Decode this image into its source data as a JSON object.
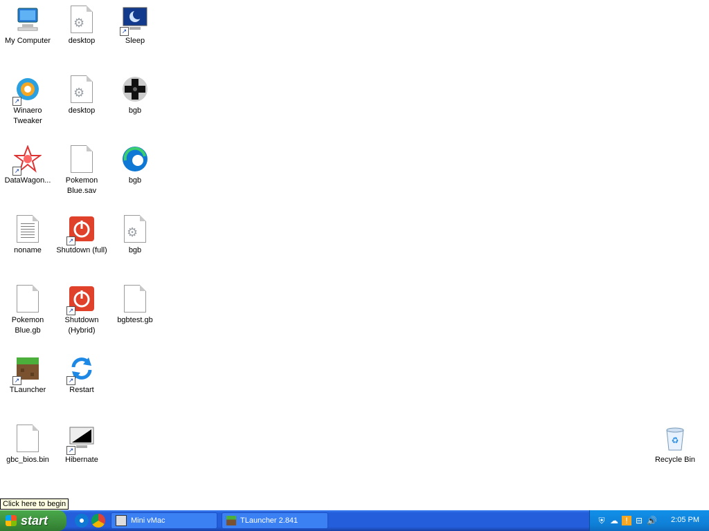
{
  "desktop": {
    "icons": [
      {
        "label": "My Computer"
      },
      {
        "label": "desktop"
      },
      {
        "label": "Sleep"
      },
      {
        "label": "Winaero Tweaker"
      },
      {
        "label": "desktop"
      },
      {
        "label": "bgb"
      },
      {
        "label": "DataWagon..."
      },
      {
        "label": "Pokemon Blue.sav"
      },
      {
        "label": "bgb"
      },
      {
        "label": "noname"
      },
      {
        "label": "Shutdown (full)"
      },
      {
        "label": "bgb"
      },
      {
        "label": "Pokemon Blue.gb"
      },
      {
        "label": "Shutdown (Hybrid)"
      },
      {
        "label": "bgbtest.gb"
      },
      {
        "label": "TLauncher"
      },
      {
        "label": "Restart"
      },
      {
        "label": "gbc_bios.bin"
      },
      {
        "label": "Hibernate"
      },
      {
        "label": "Recycle Bin"
      }
    ]
  },
  "tooltip": "Click here to begin",
  "taskbar": {
    "start_label": "start",
    "tasks": [
      {
        "label": "Mini vMac"
      },
      {
        "label": "TLauncher 2.841"
      }
    ],
    "clock": "2:05 PM"
  },
  "colors": {
    "taskbar": "#245edb",
    "start": "#3c8f3c",
    "tray": "#0f7fd6"
  }
}
